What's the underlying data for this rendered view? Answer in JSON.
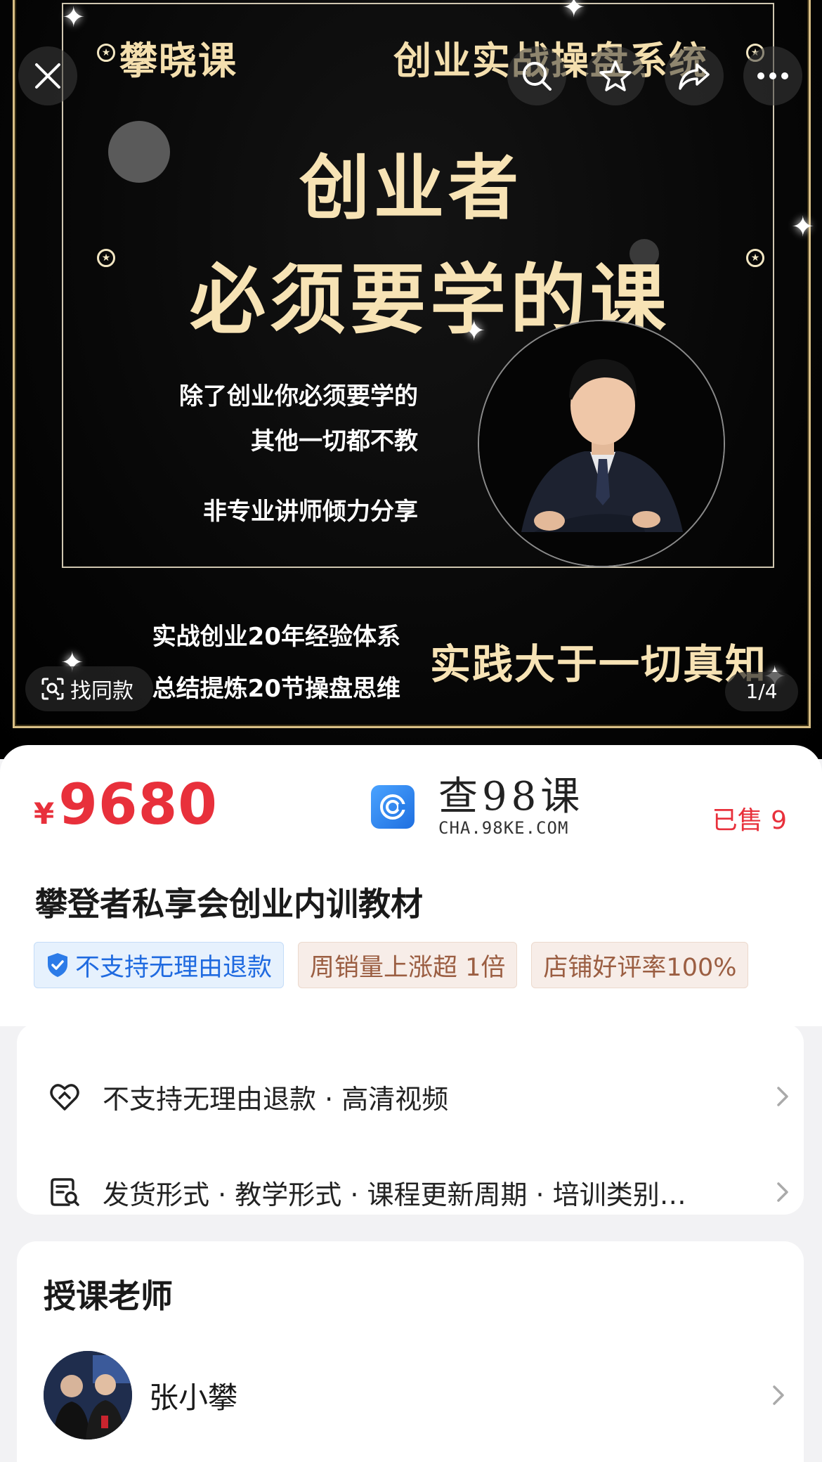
{
  "banner": {
    "brand": "攀晓课",
    "system": "创业实战操盘系统",
    "headline_line1": "创业者",
    "headline_line2": "必须要学的课",
    "taglines": [
      "除了创业你必须要学的",
      "其他一切都不教",
      "非专业讲师倾力分享"
    ],
    "bottom_lines": [
      "实战创业20年经验体系",
      "总结提炼20节操盘思维"
    ],
    "slogan": "实践大于一切真知",
    "find_same_label": "找同款",
    "page_indicator": "1/4"
  },
  "toolbar": {
    "close_icon": "close-icon",
    "search_icon": "search-icon",
    "favorite_icon": "star-icon",
    "share_icon": "share-icon",
    "more_icon": "more-icon"
  },
  "product": {
    "currency": "¥",
    "price": "9680",
    "sold": "已售 9",
    "title": "攀登者私享会创业内训教材",
    "tags": [
      {
        "label": "不支持无理由退款"
      },
      {
        "label": "周销量上涨超 1倍"
      },
      {
        "label": "店铺好评率100%"
      }
    ]
  },
  "watermark": {
    "main": "查98课",
    "sub": "CHA.98KE.COM"
  },
  "services": [
    {
      "label": "不支持无理由退款 · 高清视频"
    },
    {
      "label": "发货形式 · 教学形式 · 课程更新周期 · 培训类别…"
    }
  ],
  "teacher": {
    "heading": "授课老师",
    "name": "张小攀"
  },
  "colors": {
    "price_red": "#e8303b",
    "gold": "#f7e3b5",
    "tag_blue": "#1f6ae0",
    "tag_brown": "#9b5e42"
  }
}
